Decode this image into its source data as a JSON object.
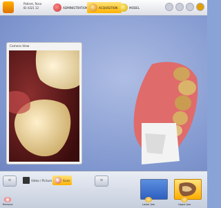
{
  "header": {
    "patient_name": "Patient, Rosa",
    "patient_id": "ID 4321 12",
    "phases": [
      {
        "label": "ADMINISTRATION",
        "active": false
      },
      {
        "label": "ACQUISITION",
        "active": true
      },
      {
        "label": "MODEL",
        "active": false
      }
    ]
  },
  "camera_window": {
    "title": "Camera View"
  },
  "bottom": {
    "modes": [
      {
        "label": "Video / Picture",
        "active": false
      },
      {
        "label": "Scan",
        "active": true
      }
    ],
    "tools": {
      "remove": "Remove",
      "lower_jaw": "Lower Jaw",
      "upper_jaw": "Upper Jaw"
    }
  },
  "colors": {
    "accent": "#ffb200",
    "background": "#8aa3d6",
    "bar": "#e9edf4"
  }
}
